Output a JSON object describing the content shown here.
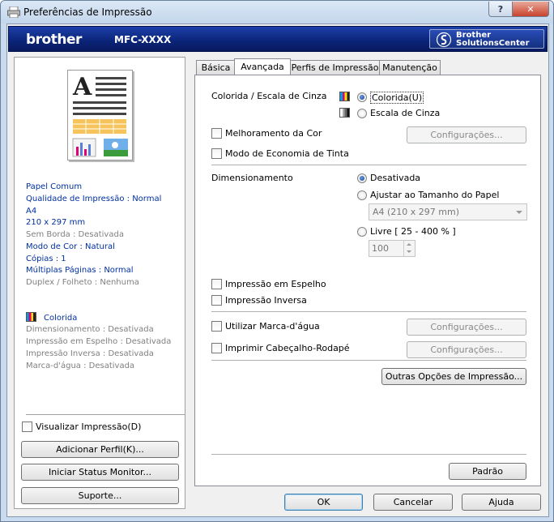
{
  "window": {
    "title": "Preferências de Impressão",
    "help": "?",
    "close": "✕"
  },
  "banner": {
    "logo": "brother",
    "model": "MFC-XXXX",
    "solutions_line1": "Brother",
    "solutions_line2": "SolutionsCenter"
  },
  "summary": {
    "lines": [
      {
        "text": "Papel Comum",
        "active": true
      },
      {
        "text": "Qualidade de Impressão : Normal",
        "active": true
      },
      {
        "text": "A4",
        "active": true
      },
      {
        "text": "210 x 297 mm",
        "active": true
      },
      {
        "text": "Sem Borda : Desativada",
        "active": false
      },
      {
        "text": "Modo de Cor : Natural",
        "active": true
      },
      {
        "text": "Cópias : 1",
        "active": true
      },
      {
        "text": "Múltiplas Páginas : Normal",
        "active": true
      },
      {
        "text": "Duplex / Folheto : Nenhuma",
        "active": false
      }
    ],
    "color_label": "Colorida",
    "color_lines": [
      "Dimensionamento : Desativada",
      "Impressão em Espelho : Desativada",
      "Impressão Inversa : Desativada",
      "Marca-d'água : Desativada"
    ],
    "preview_checkbox": "Visualizar Impressão(D)",
    "preview_checked": false,
    "add_profile": "Adicionar Perfil(K)...",
    "status_monitor": "Iniciar Status Monitor...",
    "support": "Suporte..."
  },
  "tabs": [
    {
      "label": "Básica",
      "active": false
    },
    {
      "label": "Avançada",
      "active": true
    },
    {
      "label": "Perfis de Impressão",
      "active": false
    },
    {
      "label": "Manutenção",
      "active": false
    }
  ],
  "advanced": {
    "color_group_label": "Colorida / Escala de Cinza",
    "color_option": "Colorida(U)",
    "gray_option": "Escala de Cinza",
    "selected_color_mode": "Colorida",
    "color_enhance": "Melhoramento da Cor",
    "color_enhance_settings": "Configurações...",
    "ink_save": "Modo de Economia de Tinta",
    "scaling_label": "Dimensionamento",
    "scaling_off": "Desativada",
    "scaling_fit": "Ajustar ao Tamanho do Papel",
    "paper_size_value": "A4 (210 x 297 mm)",
    "scaling_free": "Livre [ 25 - 400 % ]",
    "free_value": "100",
    "selected_scaling": "Desativada",
    "mirror": "Impressão em Espelho",
    "reverse": "Impressão Inversa",
    "watermark": "Utilizar Marca-d'água",
    "watermark_settings": "Configurações...",
    "header_footer": "Imprimir Cabeçalho-Rodapé",
    "header_footer_settings": "Configurações...",
    "other_options": "Outras Opções de Impressão...",
    "default_button": "Padrão"
  },
  "footer": {
    "ok": "OK",
    "cancel": "Cancelar",
    "help": "Ajuda"
  },
  "colors": {
    "banner": "#0b2478",
    "summary_blue": "#0030a0",
    "disabled_gray": "#808080"
  }
}
